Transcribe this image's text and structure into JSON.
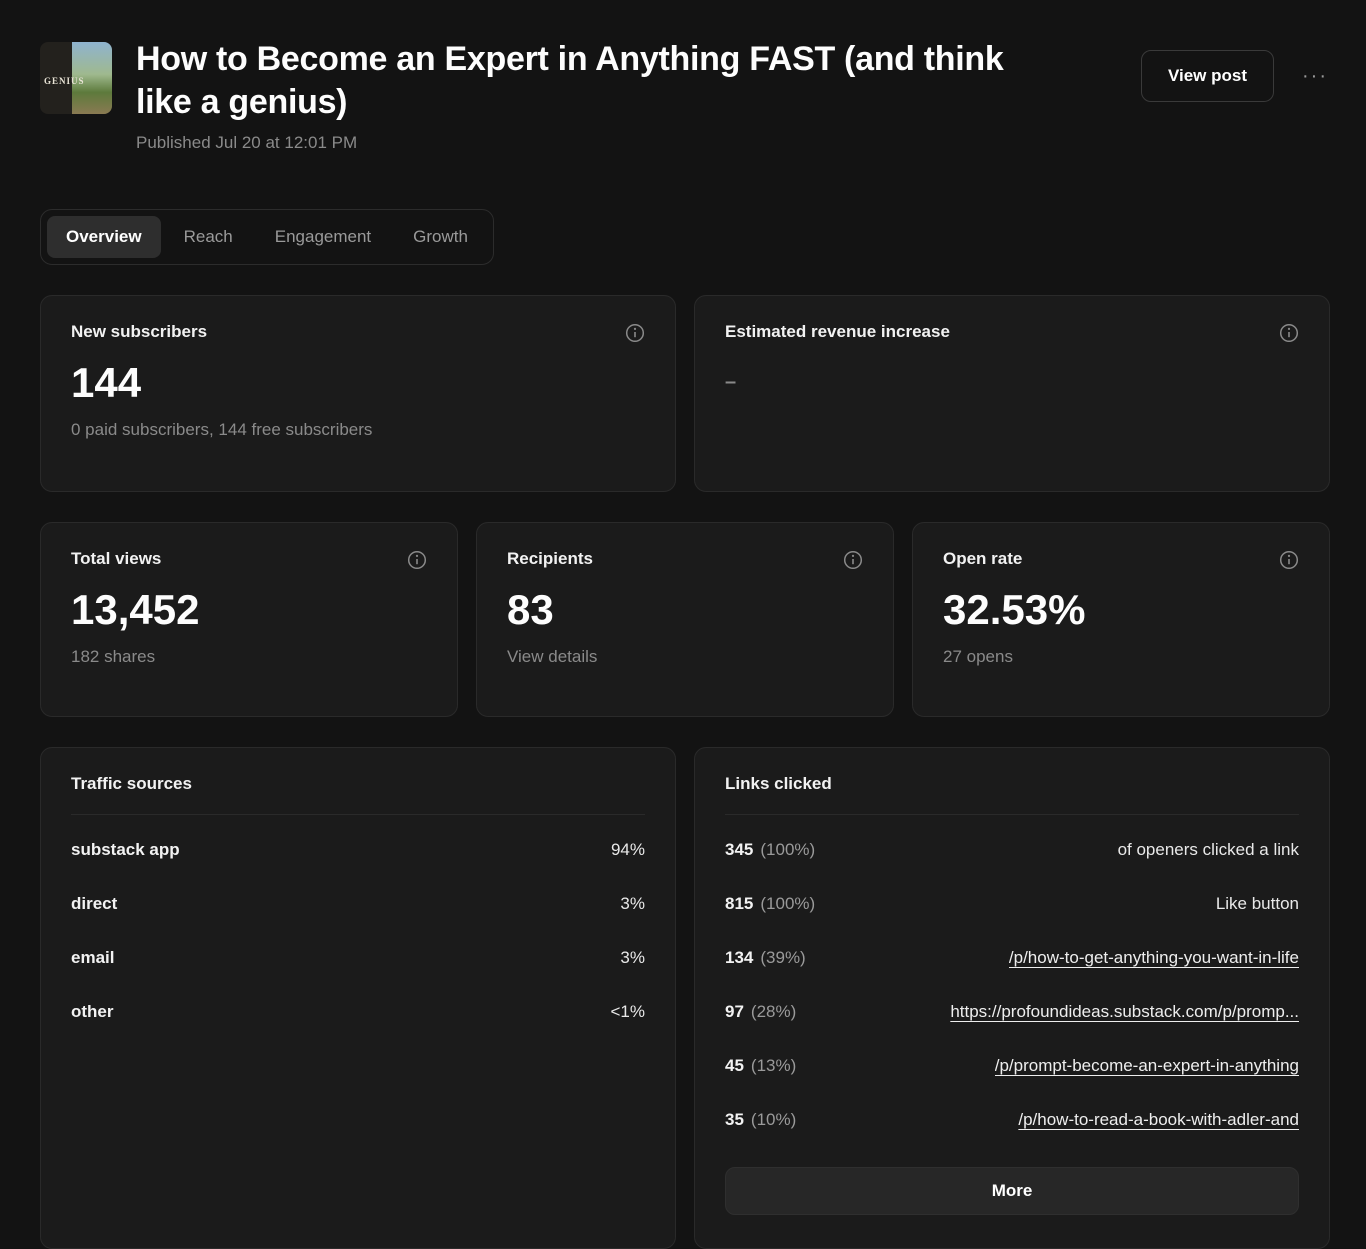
{
  "header": {
    "title": "How to Become an Expert in Anything FAST (and think like a genius)",
    "published": "Published Jul 20 at 12:01 PM",
    "view_post_label": "View post",
    "more_label": "···",
    "thumbnail_text": "GENIUS"
  },
  "tabs": [
    {
      "label": "Overview",
      "active": true
    },
    {
      "label": "Reach",
      "active": false
    },
    {
      "label": "Engagement",
      "active": false
    },
    {
      "label": "Growth",
      "active": false
    }
  ],
  "stats": {
    "new_subscribers": {
      "title": "New subscribers",
      "value": "144",
      "subtitle": "0 paid subscribers, 144 free subscribers"
    },
    "revenue": {
      "title": "Estimated revenue increase",
      "value": "–"
    },
    "total_views": {
      "title": "Total views",
      "value": "13,452",
      "subtitle": "182 shares"
    },
    "recipients": {
      "title": "Recipients",
      "value": "83",
      "subtitle": "View details"
    },
    "open_rate": {
      "title": "Open rate",
      "value": "32.53%",
      "subtitle": "27 opens"
    }
  },
  "traffic": {
    "title": "Traffic sources",
    "rows": [
      {
        "label": "substack app",
        "value": "94%"
      },
      {
        "label": "direct",
        "value": "3%"
      },
      {
        "label": "email",
        "value": "3%"
      },
      {
        "label": "other",
        "value": "<1%"
      }
    ]
  },
  "links": {
    "title": "Links clicked",
    "rows": [
      {
        "count": "345",
        "pct": "(100%)",
        "label": "of openers clicked a link"
      },
      {
        "count": "815",
        "pct": "(100%)",
        "label": "Like button"
      },
      {
        "count": "134",
        "pct": "(39%)",
        "label": "/p/how-to-get-anything-you-want-in-life"
      },
      {
        "count": "97",
        "pct": "(28%)",
        "label": "https://profoundideas.substack.com/p/promp..."
      },
      {
        "count": "45",
        "pct": "(13%)",
        "label": "/p/prompt-become-an-expert-in-anything"
      },
      {
        "count": "35",
        "pct": "(10%)",
        "label": "/p/how-to-read-a-book-with-adler-and"
      }
    ],
    "more_label": "More"
  },
  "colors": {
    "page_bg": "#131313",
    "card_bg": "#1b1b1b",
    "card_border": "#2a2a2a",
    "muted_text": "#8a8a8a"
  }
}
